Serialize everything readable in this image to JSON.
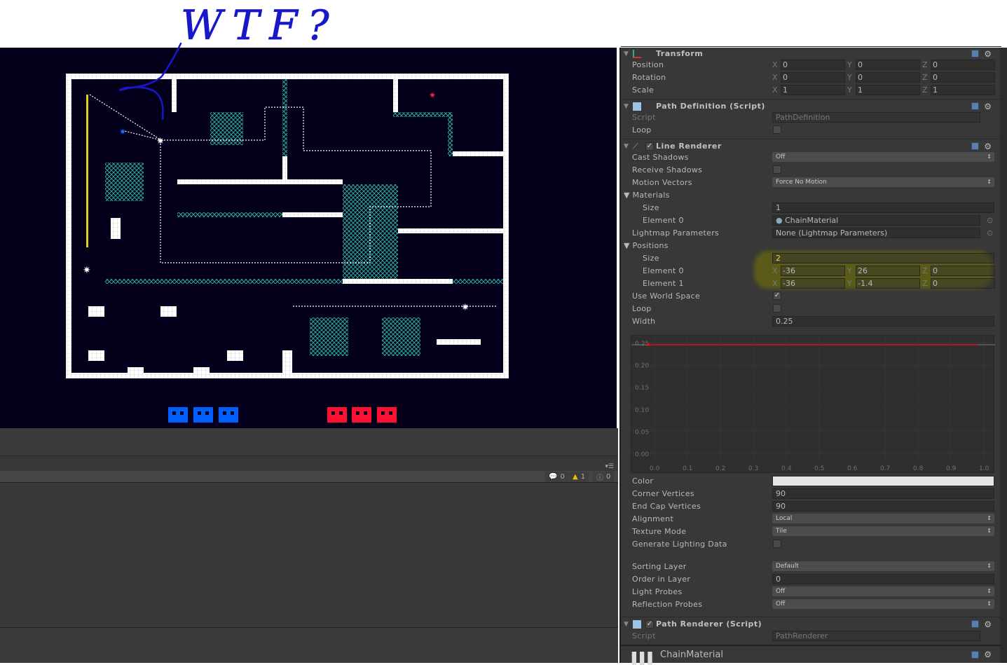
{
  "annotation": {
    "text": "WTF?",
    "color": "#1818c8"
  },
  "game": {
    "background": "#04001c",
    "wall_color": "#ffffff",
    "hazard_color": "#2fa58f",
    "team_blue": "#0060ff",
    "team_red": "#ff1030",
    "blue_count": 3,
    "red_count": 3
  },
  "console": {
    "errors": "0",
    "warnings": "1",
    "messages": "0",
    "menu_icon": "menu-icon"
  },
  "inspector": {
    "transform": {
      "title": "Transform",
      "rows": [
        {
          "label": "Position",
          "x": "0",
          "y": "0",
          "z": "0"
        },
        {
          "label": "Rotation",
          "x": "0",
          "y": "0",
          "z": "0"
        },
        {
          "label": "Scale",
          "x": "1",
          "y": "1",
          "z": "1"
        }
      ]
    },
    "path_definition": {
      "title": "Path Definition (Script)",
      "script_label": "Script",
      "script_value": "PathDefinition",
      "loop_label": "Loop",
      "loop": false
    },
    "line_renderer": {
      "title": "Line Renderer",
      "enabled": true,
      "cast_shadows_label": "Cast Shadows",
      "cast_shadows": "Off",
      "receive_shadows_label": "Receive Shadows",
      "receive_shadows": false,
      "motion_vectors_label": "Motion Vectors",
      "motion_vectors": "Force No Motion",
      "materials_label": "Materials",
      "size_label": "Size",
      "materials_size": "1",
      "element0_label": "Element 0",
      "material0": "ChainMaterial",
      "lightmap_label": "Lightmap Parameters",
      "lightmap": "None (Lightmap Parameters)",
      "positions_label": "Positions",
      "positions_size": "2",
      "positions": [
        {
          "label": "Element 0",
          "x": "-36",
          "y": "26",
          "z": "0"
        },
        {
          "label": "Element 1",
          "x": "-36",
          "y": "-1.4",
          "z": "0"
        }
      ],
      "world_space_label": "Use World Space",
      "world_space": true,
      "loop_label": "Loop",
      "loop": false,
      "width_label": "Width",
      "width": "0.25",
      "curve": {
        "y_ticks": [
          "0.25",
          "0.20",
          "0.15",
          "0.10",
          "0.05",
          "0.00"
        ],
        "x_ticks": [
          "0.0",
          "0.1",
          "0.2",
          "0.3",
          "0.4",
          "0.5",
          "0.6",
          "0.7",
          "0.8",
          "0.9",
          "1.0"
        ],
        "value": 0.25,
        "color": "#e01010"
      },
      "color_label": "Color",
      "color": "#e6e6e6",
      "corner_label": "Corner Vertices",
      "corner": "90",
      "endcap_label": "End Cap Vertices",
      "endcap": "90",
      "alignment_label": "Alignment",
      "alignment": "Local",
      "texture_mode_label": "Texture Mode",
      "texture_mode": "Tile",
      "gen_lighting_label": "Generate Lighting Data",
      "gen_lighting": false,
      "sorting_layer_label": "Sorting Layer",
      "sorting_layer": "Default",
      "order_label": "Order in Layer",
      "order": "0",
      "light_probes_label": "Light Probes",
      "light_probes": "Off",
      "reflection_label": "Reflection Probes",
      "reflection": "Off"
    },
    "path_renderer": {
      "title": "Path Renderer (Script)",
      "enabled": true,
      "script_label": "Script",
      "script_value": "PathRenderer"
    },
    "material": {
      "title": "ChainMaterial"
    }
  }
}
